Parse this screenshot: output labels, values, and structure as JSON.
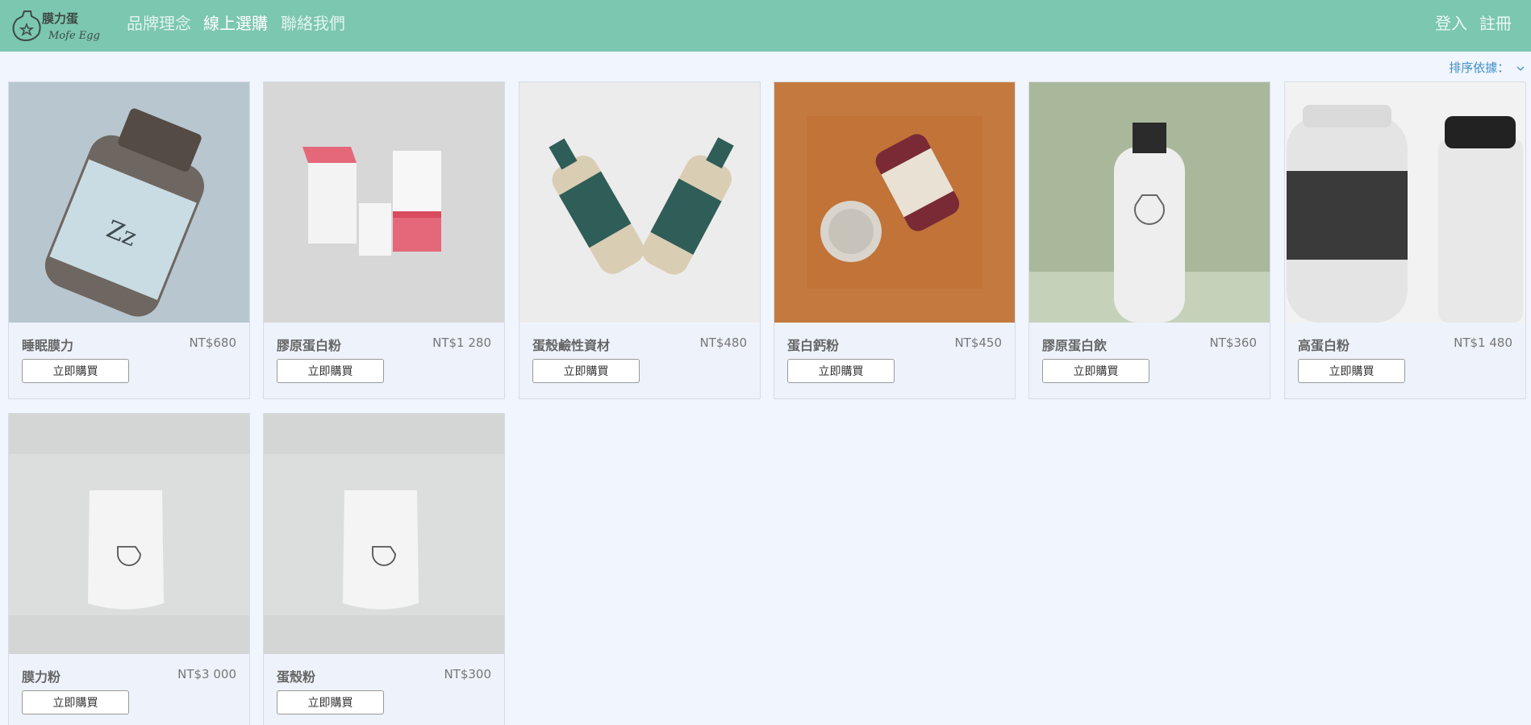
{
  "nav": {
    "logo_text_top": "膜力蛋",
    "logo_text_bottom": "Mofe Egg",
    "links": [
      "品牌理念",
      "線上選購",
      "聯絡我們"
    ],
    "login": "登入",
    "register": "註冊"
  },
  "sort_label": "排序依據：",
  "buy_label": "立即購買",
  "products": [
    {
      "name": "睡眠膜力",
      "price": "NT$680",
      "image": "sleep-supplement-bottle"
    },
    {
      "name": "膠原蛋白粉",
      "price": "NT$1 280",
      "image": "collagen-box-package"
    },
    {
      "name": "蛋殼鹼性資材",
      "price": "NT$480",
      "image": "eggshell-alkaline-bottles"
    },
    {
      "name": "蛋白鈣粉",
      "price": "NT$450",
      "image": "protein-calcium-jar"
    },
    {
      "name": "膠原蛋白飲",
      "price": "NT$360",
      "image": "collagen-drink-bottle"
    },
    {
      "name": "高蛋白粉",
      "price": "NT$1 480",
      "image": "protein-tub-shaker"
    },
    {
      "name": "膜力粉",
      "price": "NT$3 000",
      "image": "membrane-powder-pouch"
    },
    {
      "name": "蛋殼粉",
      "price": "NT$300",
      "image": "eggshell-powder-pouch"
    }
  ],
  "colors": {
    "navbar": "#7cc7b0",
    "page_bg": "#f1f5fd",
    "sort_link": "#3a8fc4"
  }
}
